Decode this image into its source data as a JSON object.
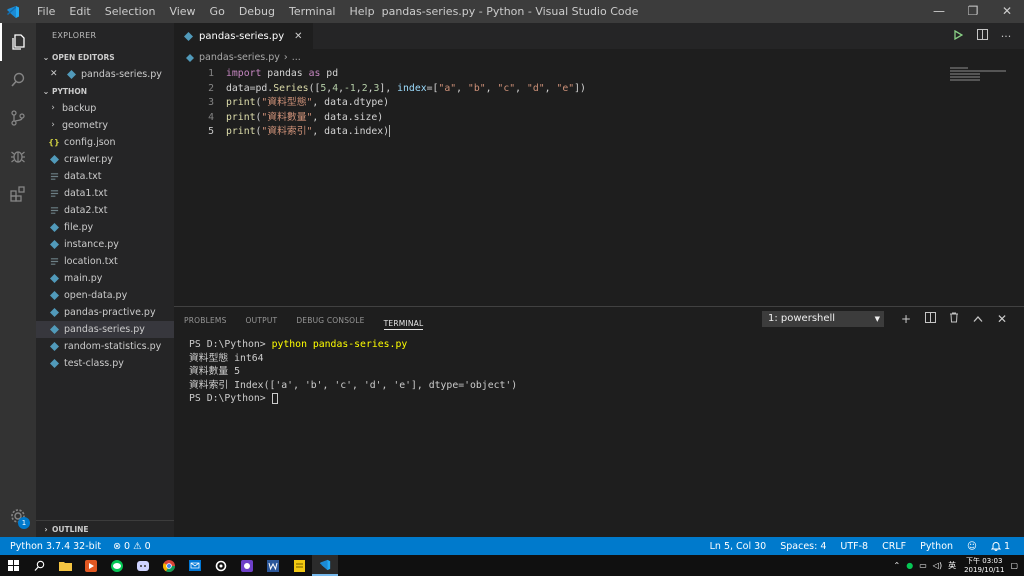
{
  "titlebar": {
    "menu": [
      "File",
      "Edit",
      "Selection",
      "View",
      "Go",
      "Debug",
      "Terminal",
      "Help"
    ],
    "title": "pandas-series.py - Python - Visual Studio Code",
    "minimize": "—",
    "maximize": "❐",
    "close": "✕"
  },
  "activity": {
    "icons": [
      "files-icon",
      "search-icon",
      "source-control-icon",
      "debug-icon",
      "extensions-icon"
    ],
    "settings_badge": "1"
  },
  "sidebar": {
    "title": "EXPLORER",
    "open_editors_label": "OPEN EDITORS",
    "open_editors": [
      {
        "name": "pandas-series.py",
        "close": "✕"
      }
    ],
    "folder_label": "PYTHON",
    "folders": [
      "backup",
      "geometry"
    ],
    "files": [
      {
        "name": "config.json",
        "kind": "json"
      },
      {
        "name": "crawler.py",
        "kind": "py"
      },
      {
        "name": "data.txt",
        "kind": "txt"
      },
      {
        "name": "data1.txt",
        "kind": "txt"
      },
      {
        "name": "data2.txt",
        "kind": "txt"
      },
      {
        "name": "file.py",
        "kind": "py"
      },
      {
        "name": "instance.py",
        "kind": "py"
      },
      {
        "name": "location.txt",
        "kind": "txt"
      },
      {
        "name": "main.py",
        "kind": "py"
      },
      {
        "name": "open-data.py",
        "kind": "py"
      },
      {
        "name": "pandas-practive.py",
        "kind": "py"
      },
      {
        "name": "pandas-series.py",
        "kind": "py",
        "selected": true
      },
      {
        "name": "random-statistics.py",
        "kind": "py"
      },
      {
        "name": "test-class.py",
        "kind": "py"
      }
    ],
    "outline_label": "OUTLINE"
  },
  "editor": {
    "tab_label": "pandas-series.py",
    "tab_close": "✕",
    "breadcrumb_file": "pandas-series.py",
    "breadcrumb_rest": "...",
    "line_numbers": [
      "1",
      "2",
      "3",
      "4",
      "5"
    ],
    "code": {
      "l1": {
        "kw_import": "import",
        "mod": "pandas",
        "kw_as": "as",
        "alias": "pd"
      },
      "l2": {
        "p1": "data=pd.",
        "call": "Series",
        "p2": "([",
        "n1": "5",
        "c1": ",",
        "n2": "4",
        "c2": ",",
        "n3": "-1",
        "c3": ",",
        "n4": "2",
        "c4": ",",
        "n5": "3",
        "p3": "], ",
        "kwarg": "index",
        "p4": "=[",
        "s1": "\"a\"",
        "c5": ", ",
        "s2": "\"b\"",
        "c6": ", ",
        "s3": "\"c\"",
        "c7": ", ",
        "s4": "\"d\"",
        "c8": ", ",
        "s5": "\"e\"",
        "p5": "])"
      },
      "l3": {
        "fn": "print",
        "open": "(",
        "str": "\"資料型態\"",
        "rest": ", data.dtype)"
      },
      "l4": {
        "fn": "print",
        "open": "(",
        "str": "\"資料數量\"",
        "rest": ", data.size)"
      },
      "l5": {
        "fn": "print",
        "open": "(",
        "str": "\"資料索引\"",
        "rest": ", data.index)"
      }
    }
  },
  "panel": {
    "tabs": [
      "PROBLEMS",
      "OUTPUT",
      "DEBUG CONSOLE",
      "TERMINAL"
    ],
    "active_tab": "TERMINAL",
    "terminal_select": "1: powershell",
    "terminal_lines": {
      "prompt1": "PS D:\\Python> ",
      "cmd1": "python pandas-series.py",
      "out1": "資料型態 int64",
      "out2": "資料數量 5",
      "out3": "資料索引 Index(['a', 'b', 'c', 'd', 'e'], dtype='object')",
      "prompt2": "PS D:\\Python> "
    }
  },
  "statusbar": {
    "python": "Python 3.7.4 32-bit",
    "problems": "⊗ 0 ⚠ 0",
    "position": "Ln 5, Col 30",
    "spaces": "Spaces: 4",
    "encoding": "UTF-8",
    "eol": "CRLF",
    "language": "Python",
    "notifications": "1"
  },
  "taskbar": {
    "ime": "英",
    "time": "下午 03:03",
    "date": "2019/10/11"
  },
  "colors": {
    "accent": "#007acc",
    "keyword": "#c586c0",
    "function": "#dcdcaa",
    "string": "#ce9178",
    "number": "#b5cea8"
  }
}
